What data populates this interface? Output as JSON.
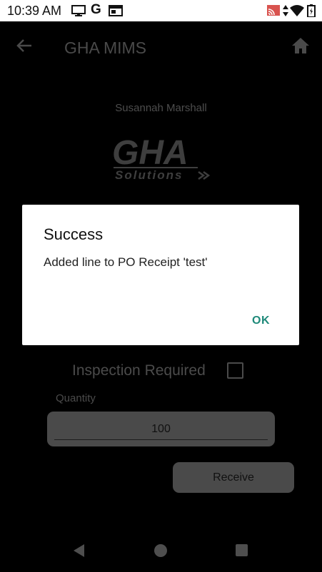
{
  "status_bar": {
    "time": "10:39 AM",
    "g_label": "G",
    "icons": [
      "screen-share-icon",
      "google-icon",
      "calendar-icon",
      "cast-icon",
      "data-arrows-icon",
      "wifi-icon",
      "battery-icon"
    ]
  },
  "app_bar": {
    "title": "GHA MIMS",
    "back_icon": "arrow-left-icon",
    "home_icon": "home-icon"
  },
  "user": {
    "name": "Susannah Marshall"
  },
  "logo": {
    "text_main": "GHA",
    "text_sub": "Solutions"
  },
  "form": {
    "inspection_label": "Inspection Required",
    "inspection_checked": false,
    "quantity_label": "Quantity",
    "quantity_value": "100",
    "receive_label": "Receive"
  },
  "dialog": {
    "title": "Success",
    "message": "Added line to PO Receipt 'test'",
    "ok_label": "OK"
  },
  "colors": {
    "dialog_accent": "#1f8a7a",
    "dimmed_control": "#4a4a4a"
  }
}
